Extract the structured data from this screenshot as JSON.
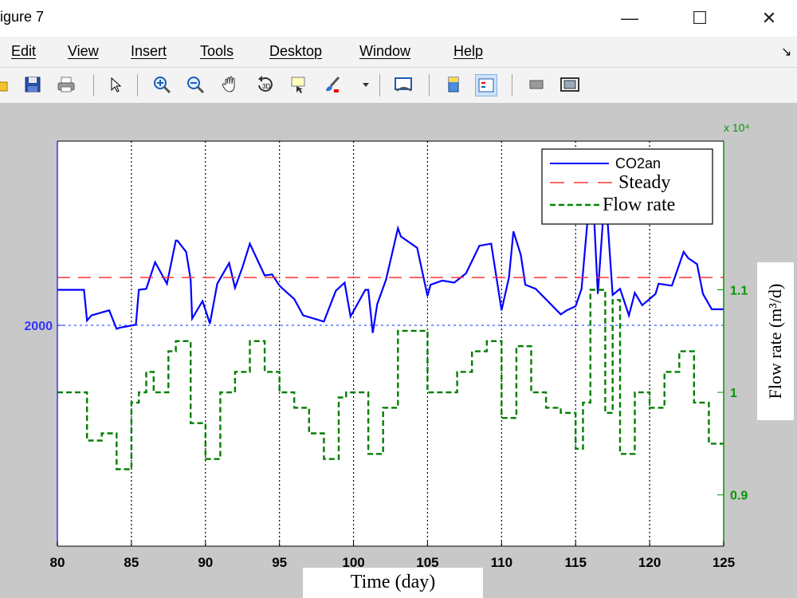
{
  "window": {
    "title": "igure 7",
    "minimize_glyph": "—",
    "maximize_glyph": "☐",
    "close_glyph": "✕"
  },
  "menu": {
    "items": [
      "Edit",
      "View",
      "Insert",
      "Tools",
      "Desktop",
      "Window",
      "Help"
    ],
    "overflow_glyph": "↘"
  },
  "toolbar": {
    "icons": [
      "open-file-icon",
      "save-icon",
      "print-icon",
      "pointer-icon",
      "zoom-in-icon",
      "zoom-out-icon",
      "pan-hand-icon",
      "rotate-3d-icon",
      "data-cursor-icon",
      "brush-icon",
      "brush-dropdown-icon",
      "link-plot-icon",
      "colorbar-icon",
      "legend-icon",
      "hide-plot-tools-icon",
      "show-plot-tools-icon"
    ]
  },
  "chart_data": {
    "type": "line",
    "xlabel": "Time (day)",
    "ylabel_right": "Flow rate (m³/d)",
    "right_axis_multiplier": "x 10⁴",
    "xlim": [
      80,
      125
    ],
    "x_ticks": [
      "80",
      "85",
      "90",
      "95",
      "100",
      "105",
      "110",
      "115",
      "120",
      "125"
    ],
    "y_left_ticks": [
      "2000"
    ],
    "y_right_ticks": [
      "0.9",
      "1",
      "1.1"
    ],
    "y_right_lim": [
      0.85,
      1.245
    ],
    "grid": "vertical dotted at each x tick",
    "legend_placement": "top-right",
    "colors": {
      "co2": "#0000ff",
      "steady": "#ff3333",
      "flow": "#007f00",
      "axis_left": "#3333ff",
      "axis_right": "#009900"
    },
    "series": [
      {
        "name": "CO2an",
        "x": [
          80,
          81.8,
          82,
          82.3,
          83.5,
          84,
          84.2,
          85.3,
          85.5,
          86,
          86.6,
          87.4,
          88,
          88.1,
          88.7,
          89,
          89.1,
          89.8,
          90.3,
          90.8,
          91.6,
          92,
          92.5,
          93,
          94,
          94.5,
          95,
          95.3,
          96,
          96.6,
          98,
          98.8,
          99.4,
          99.8,
          100.8,
          101,
          101.3,
          101.6,
          102.2,
          103,
          103.2,
          104.3,
          105,
          105.2,
          106,
          106.8,
          107.6,
          108.5,
          109.3,
          110,
          110.5,
          110.8,
          111.3,
          111.6,
          112.3,
          114,
          114.4,
          115,
          115.4,
          116,
          116.2,
          116.5,
          117,
          117.5,
          118,
          118.6,
          119,
          119.5,
          120.4,
          120.6,
          121.5,
          122.3,
          122.6,
          123.2,
          123.6,
          124.2,
          125
        ],
        "y_right": [
          1.1,
          1.1,
          1.07,
          1.075,
          1.08,
          1.062,
          1.063,
          1.066,
          1.1,
          1.101,
          1.127,
          1.106,
          1.148,
          1.148,
          1.137,
          1.11,
          1.072,
          1.089,
          1.067,
          1.106,
          1.126,
          1.102,
          1.122,
          1.145,
          1.114,
          1.115,
          1.104,
          1.1,
          1.091,
          1.075,
          1.069,
          1.099,
          1.107,
          1.074,
          1.1,
          1.1,
          1.058,
          1.086,
          1.11,
          1.16,
          1.152,
          1.141,
          1.094,
          1.105,
          1.109,
          1.107,
          1.116,
          1.143,
          1.145,
          1.08,
          1.112,
          1.157,
          1.134,
          1.105,
          1.101,
          1.076,
          1.08,
          1.084,
          1.101,
          1.2,
          1.185,
          1.096,
          1.2,
          1.095,
          1.101,
          1.075,
          1.097,
          1.085,
          1.096,
          1.106,
          1.104,
          1.137,
          1.131,
          1.125,
          1.096,
          1.081,
          1.081
        ]
      },
      {
        "name": "Steady",
        "x": [
          80,
          125
        ],
        "y_right": [
          1.112,
          1.112
        ]
      },
      {
        "name": "Flow rate",
        "x": [
          80,
          82,
          82,
          83,
          83,
          84,
          84,
          85,
          85,
          85.5,
          85.5,
          86,
          86,
          86.5,
          86.5,
          87.5,
          87.5,
          88,
          88,
          89,
          89,
          90,
          90,
          91,
          91,
          92,
          92,
          93,
          93,
          94,
          94,
          95,
          95,
          96,
          96,
          97,
          97,
          98,
          98,
          99,
          99,
          99.5,
          99.5,
          101,
          101,
          102,
          102,
          103,
          103,
          105,
          105,
          107,
          107,
          108,
          108,
          109,
          109,
          110,
          110,
          111,
          111,
          112,
          112,
          113,
          113,
          114,
          114,
          115,
          115,
          115.5,
          115.5,
          116,
          116,
          117,
          117,
          117.5,
          117.5,
          118,
          118,
          119,
          119,
          120,
          120,
          121,
          121,
          122,
          122,
          123,
          123,
          124,
          124,
          125
        ],
        "y_right": [
          1.0,
          1.0,
          0.953,
          0.953,
          0.96,
          0.96,
          0.925,
          0.925,
          0.99,
          0.99,
          1.0,
          1.0,
          1.02,
          1.02,
          1.0,
          1.0,
          1.04,
          1.04,
          1.05,
          1.05,
          0.97,
          0.97,
          0.935,
          0.935,
          1.0,
          1.0,
          1.02,
          1.02,
          1.05,
          1.05,
          1.02,
          1.02,
          1.0,
          1.0,
          0.985,
          0.985,
          0.96,
          0.96,
          0.935,
          0.935,
          0.995,
          0.995,
          1.0,
          1.0,
          0.94,
          0.94,
          0.985,
          0.985,
          1.06,
          1.06,
          1.0,
          1.0,
          1.02,
          1.02,
          1.04,
          1.04,
          1.05,
          1.05,
          0.975,
          0.975,
          1.045,
          1.045,
          1.0,
          1.0,
          0.985,
          0.985,
          0.98,
          0.98,
          0.945,
          0.945,
          0.99,
          0.99,
          1.1,
          1.1,
          0.98,
          0.98,
          1.09,
          1.09,
          0.94,
          0.94,
          1.0,
          1.0,
          0.985,
          0.985,
          1.02,
          1.02,
          1.04,
          1.04,
          0.99,
          0.99,
          0.95,
          0.95
        ]
      }
    ]
  }
}
